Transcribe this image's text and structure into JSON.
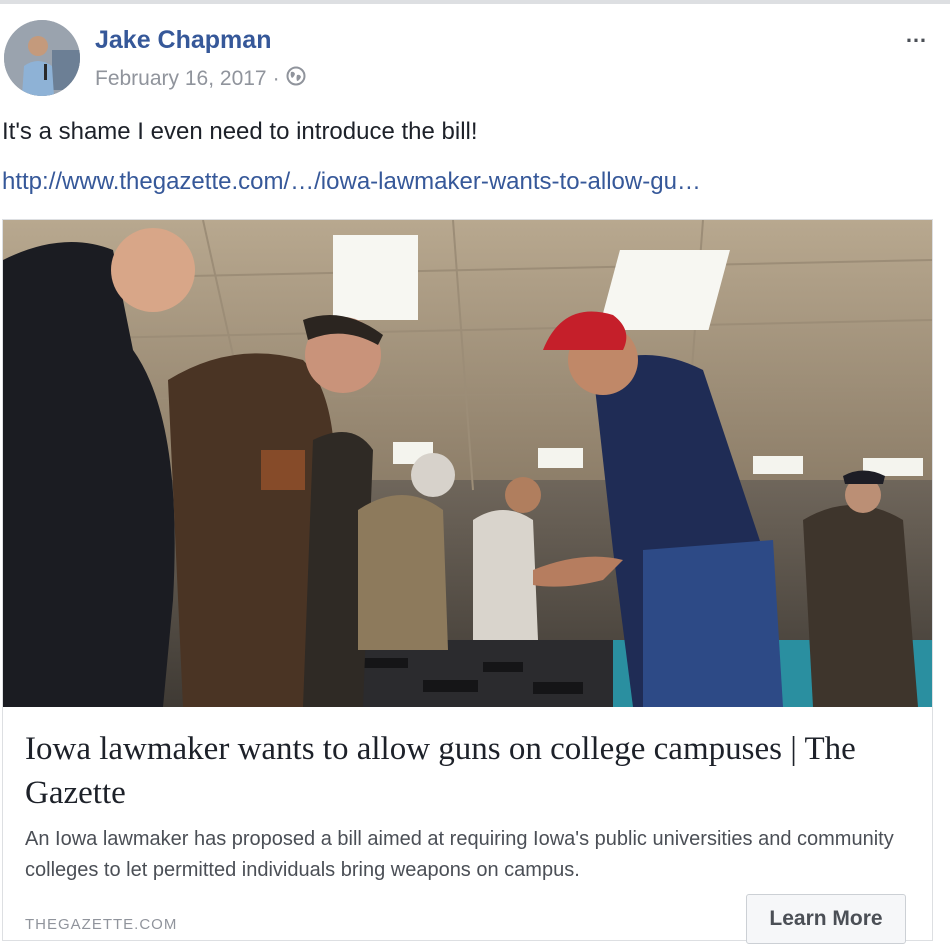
{
  "post": {
    "author": "Jake Chapman",
    "date": "February 16, 2017",
    "separator": "·",
    "more_icon": "…",
    "text": "It's a shame I even need to introduce the bill!",
    "link": "http://www.thegazette.com/…/iowa-lawmaker-wants-to-allow-gu…"
  },
  "card": {
    "title": "Iowa lawmaker wants to allow guns on college campuses | The Gazette",
    "description": "An Iowa lawmaker has proposed a bill aimed at requiring Iowa's public universities and community colleges to let permitted individuals bring weapons on campus.",
    "domain": "THEGAZETTE.COM",
    "button_label": "Learn More"
  },
  "colors": {
    "link": "#365899",
    "meta": "#90949c",
    "text": "#1d2129"
  }
}
